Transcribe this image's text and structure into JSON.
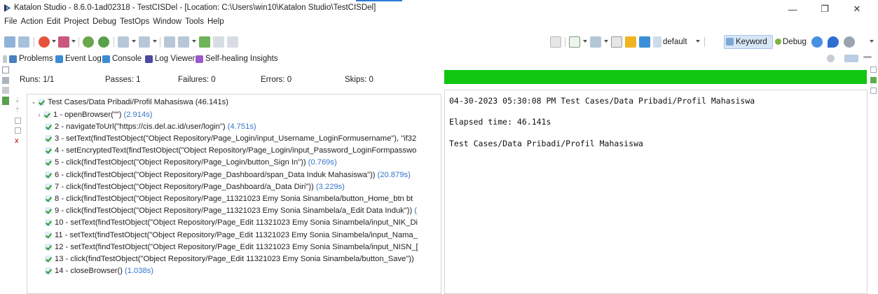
{
  "window": {
    "title": "Katalon Studio - 8.6.0-1ad02318 - TestCISDel - [Location: C:\\Users\\win10\\Katalon Studio\\TestCISDel]",
    "minimize": "—",
    "maximize": "❐",
    "close": "✕"
  },
  "menu": [
    "File",
    "Action",
    "Edit",
    "Project",
    "Debug",
    "TestOps",
    "Window",
    "Tools",
    "Help"
  ],
  "toolbar": {
    "profile_label": "default",
    "keyword_label": "Keyword",
    "debug_label": "Debug"
  },
  "view_tabs": [
    {
      "label": "Problems",
      "color": "#4a7fc1"
    },
    {
      "label": "Event Log",
      "color": "#3d8ad6"
    },
    {
      "label": "Console",
      "color": "#3d8ad6"
    },
    {
      "label": "Log Viewer",
      "color": "#4a4a9e"
    },
    {
      "label": "Self-healing Insights",
      "color": "#9b59c9"
    }
  ],
  "stats": {
    "runs": "Runs: 1/1",
    "passes": "Passes: 1",
    "failures": "Failures: 0",
    "errors": "Errors: 0",
    "skips": "Skips: 0"
  },
  "progress": {
    "fraction": 1.0,
    "color": "#11c611"
  },
  "tree": {
    "root": {
      "label": "Test Cases/Data Pribadi/Profil Mahasiswa",
      "duration": "(46.141s)"
    },
    "steps": [
      {
        "label": "1 - openBrowser(\"\")",
        "duration": "(2.914s)",
        "expandable": true
      },
      {
        "label": "2 - navigateToUrl(\"https://cis.del.ac.id/user/login\")",
        "duration": "(4.751s)"
      },
      {
        "label": "3 - setText(findTestObject(\"Object Repository/Page_Login/input_Username_LoginFormusername\"), \"if32",
        "duration": ""
      },
      {
        "label": "4 - setEncryptedText(findTestObject(\"Object Repository/Page_Login/input_Password_LoginFormpasswo",
        "duration": ""
      },
      {
        "label": "5 - click(findTestObject(\"Object Repository/Page_Login/button_Sign In\"))",
        "duration": "(0.769s)"
      },
      {
        "label": "6 - click(findTestObject(\"Object Repository/Page_Dashboard/span_Data Induk Mahasiswa\"))",
        "duration": "(20.879s)"
      },
      {
        "label": "7 - click(findTestObject(\"Object Repository/Page_Dashboard/a_Data Diri\"))",
        "duration": "(3.229s)"
      },
      {
        "label": "8 - click(findTestObject(\"Object Repository/Page_11321023 Emy Sonia Sinambela/button_Home_btn bt",
        "duration": ""
      },
      {
        "label": "9 - click(findTestObject(\"Object Repository/Page_11321023 Emy Sonia Sinambela/a_Edit Data Induk\"))",
        "duration": "("
      },
      {
        "label": "10 - setText(findTestObject(\"Object Repository/Page_Edit 11321023 Emy Sonia Sinambela/input_NIK_Di",
        "duration": ""
      },
      {
        "label": "11 - setText(findTestObject(\"Object Repository/Page_Edit 11321023 Emy Sonia Sinambela/input_Nama_",
        "duration": ""
      },
      {
        "label": "12 - setText(findTestObject(\"Object Repository/Page_Edit 11321023 Emy Sonia Sinambela/input_NISN_[",
        "duration": ""
      },
      {
        "label": "13 - click(findTestObject(\"Object Repository/Page_Edit 11321023 Emy Sonia Sinambela/button_Save\"))",
        "duration": ""
      },
      {
        "label": "14 - closeBrowser()",
        "duration": "(1.038s)"
      }
    ]
  },
  "output": {
    "line1": "04-30-2023 05:30:08 PM Test Cases/Data Pribadi/Profil Mahasiswa",
    "line2": "Elapsed time: 46.141s",
    "line3": "Test Cases/Data Pribadi/Profil Mahasiswa"
  }
}
